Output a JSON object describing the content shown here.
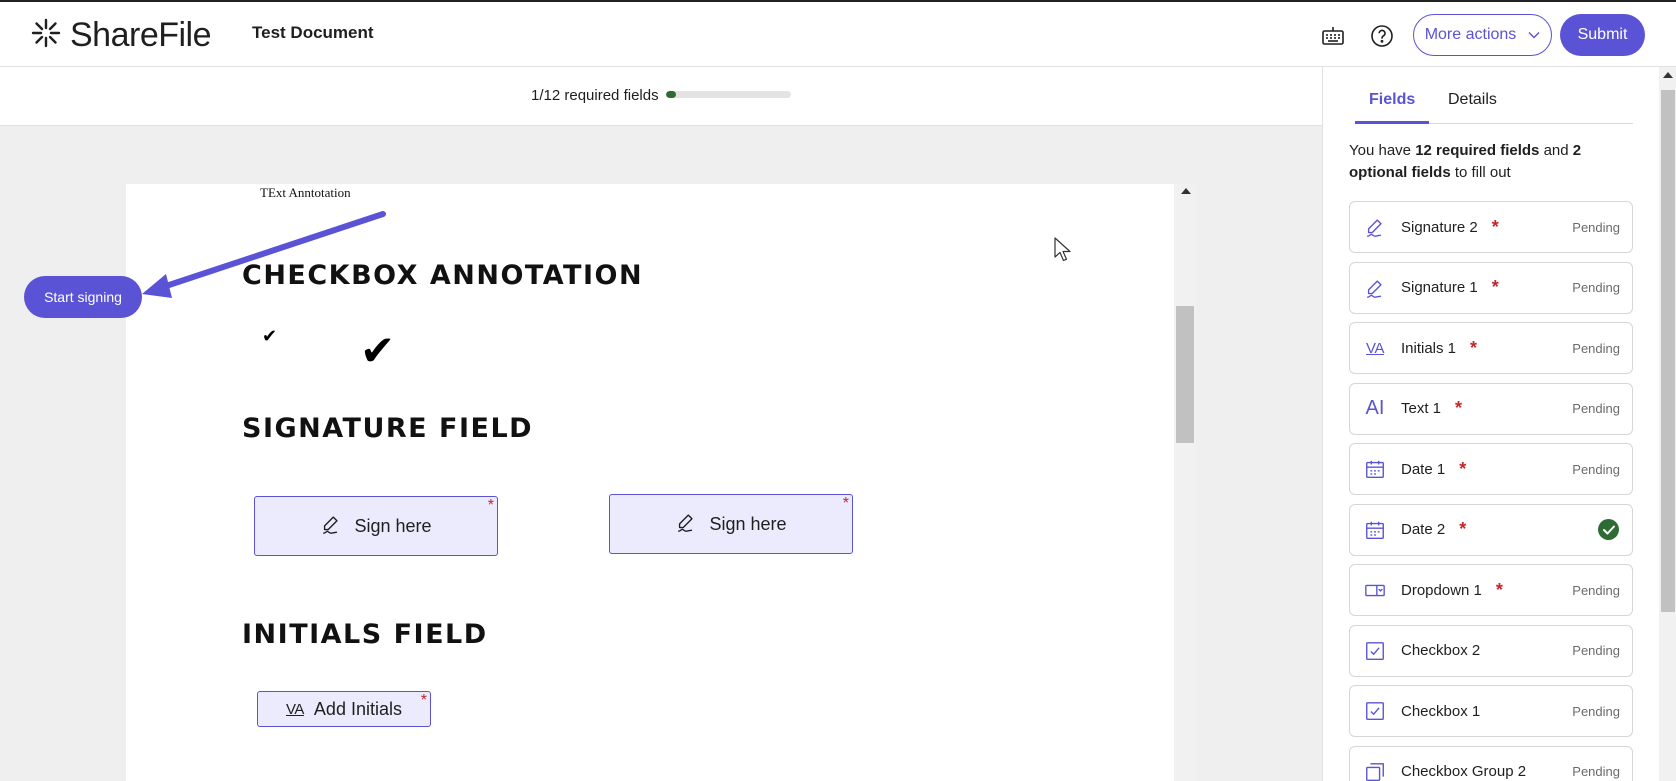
{
  "header": {
    "brand": "ShareFile",
    "document_title": "Test Document",
    "more_actions_label": "More actions",
    "submit_label": "Submit",
    "icons": [
      "sharefile-logo-icon",
      "keyboard-icon",
      "help-icon",
      "chevron-down-icon"
    ]
  },
  "progress": {
    "label": "1/12 required fields",
    "completed": 1,
    "total": 12,
    "fill_color": "#2e6b35"
  },
  "document": {
    "text_annotation": "TExt Anntotation",
    "start_signing_label": "Start signing",
    "sections": {
      "checkbox_heading": "CHECKBOX ANNOTATION",
      "signature_heading": "SIGNATURE FIELD",
      "initials_heading": "INITIALS FIELD"
    },
    "checkmark_glyph": "✔",
    "sign_here_label": "Sign here",
    "add_initials_label": "Add Initials",
    "initials_glyph": "VA",
    "required_marker": "*"
  },
  "panel": {
    "tabs": [
      {
        "label": "Fields",
        "active": true
      },
      {
        "label": "Details",
        "active": false
      }
    ],
    "summary": {
      "prefix": "You have ",
      "required": "12 required fields",
      "middle": " and ",
      "optional": "2 optional fields",
      "suffix": " to fill out"
    },
    "fields": [
      {
        "name": "Signature 2",
        "icon": "signature-icon",
        "required": "*",
        "status": "Pending"
      },
      {
        "name": "Signature 1",
        "icon": "signature-icon",
        "required": "*",
        "status": "Pending"
      },
      {
        "name": "Initials 1",
        "icon": "initials-icon",
        "required": "*",
        "status": "Pending"
      },
      {
        "name": "Text 1",
        "icon": "text-field-icon",
        "required": "*",
        "status": "Pending"
      },
      {
        "name": "Date 1",
        "icon": "calendar-icon",
        "required": "*",
        "status": "Pending"
      },
      {
        "name": "Date 2",
        "icon": "calendar-icon",
        "required": "*",
        "status": ""
      },
      {
        "name": "Dropdown 1",
        "icon": "dropdown-icon",
        "required": "*",
        "status": "Pending"
      },
      {
        "name": "Checkbox 2",
        "icon": "checkbox-icon",
        "required": "",
        "status": "Pending"
      },
      {
        "name": "Checkbox 1",
        "icon": "checkbox-icon",
        "required": "",
        "status": "Pending"
      },
      {
        "name": "Checkbox Group 2",
        "icon": "checkbox-group-icon",
        "required": "",
        "status": "Pending"
      }
    ]
  },
  "colors": {
    "accent": "#5b53d6",
    "field_background": "#eceafd",
    "required": "#c4252b",
    "success": "#2e6b35"
  }
}
